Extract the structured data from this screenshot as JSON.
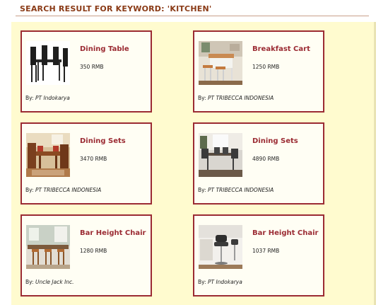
{
  "header": {
    "title": "SEARCH RESULT FOR KEYWORD: 'KITCHEN'"
  },
  "labels": {
    "by_prefix": "By:"
  },
  "products": [
    {
      "title": "Dining Table",
      "price": "350 RMB",
      "seller": "PT Indokarya",
      "image": "dining-table-photo"
    },
    {
      "title": "Breakfast Cart",
      "price": "1250 RMB",
      "seller": "PT TRIBECCA INDONESIA",
      "image": "breakfast-cart-photo"
    },
    {
      "title": "Dining Sets",
      "price": "3470 RMB",
      "seller": "PT TRIBECCA INDONESIA",
      "image": "dining-set-wood-photo"
    },
    {
      "title": "Dining Sets",
      "price": "4890 RMB",
      "seller": "PT TRIBECCA INDONESIA",
      "image": "dining-set-modern-photo"
    },
    {
      "title": "Bar Height Chair",
      "price": "1280 RMB",
      "seller": "Uncle Jack Inc.",
      "image": "bar-chair-wood-photo"
    },
    {
      "title": "Bar Height Chair",
      "price": "1037 RMB",
      "seller": "PT Indokarya",
      "image": "bar-chair-leather-photo"
    }
  ],
  "colors": {
    "accent": "#9b2b33",
    "header": "#8a3a16",
    "panel": "#fffbcf"
  }
}
